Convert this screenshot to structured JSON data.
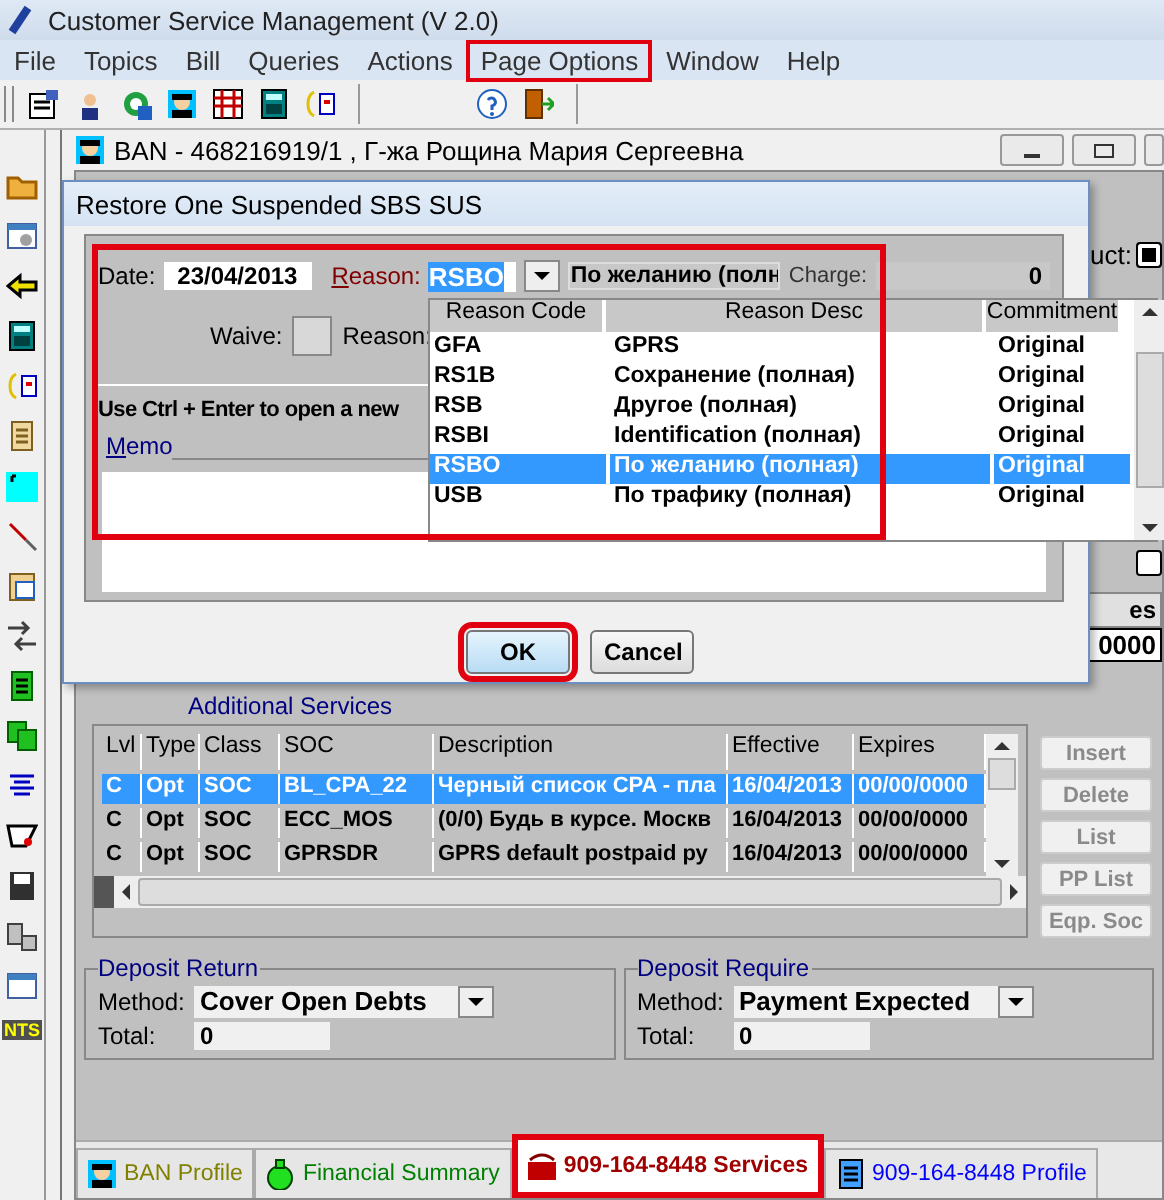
{
  "window": {
    "title": "Customer Service Management  (V 2.0)"
  },
  "menu": [
    {
      "label": "File",
      "highlighted": false
    },
    {
      "label": "Topics",
      "highlighted": false
    },
    {
      "label": "Bill",
      "highlighted": false
    },
    {
      "label": "Queries",
      "highlighted": false
    },
    {
      "label": "Actions",
      "highlighted": false
    },
    {
      "label": "Page Options",
      "highlighted": true
    },
    {
      "label": "Window",
      "highlighted": false
    },
    {
      "label": "Help",
      "highlighted": false
    }
  ],
  "left_toolbar": {
    "badge": "NTS"
  },
  "account_window": {
    "title": "BAN - 468216919/1 , Г-жа Рощина Мария Сергеевна"
  },
  "background_fields": {
    "label": "uct:",
    "checkboxes": [
      {
        "checked": true
      },
      {
        "checked": false
      }
    ],
    "button": "es",
    "value": "0000"
  },
  "dialog": {
    "title": "Restore One Suspended SBS SUS",
    "highlighted": true,
    "date_label": "Date:",
    "date": "23/04/2013",
    "reason_label": "Reason:",
    "reason_code": "RSBO",
    "reason_desc": "По желанию (полн",
    "charge_label": "Charge:",
    "charge": "0",
    "waive_label": "Waive:",
    "waive_checked": false,
    "waive_reason_label": "Reason:",
    "hint": "Use Ctrl + Enter to open a new",
    "memo_label": "Memo",
    "buttons": [
      {
        "label": "OK",
        "highlighted": true
      },
      {
        "label": "Cancel",
        "highlighted": false
      }
    ]
  },
  "reason_dropdown": {
    "columns": [
      "Reason Code",
      "Reason Desc",
      "Commitment"
    ],
    "rows": [
      {
        "code": "GFA",
        "desc": "GPRS",
        "commitment": "Original",
        "selected": false
      },
      {
        "code": "RS1B",
        "desc": "Сохранение (полная)",
        "commitment": "Original",
        "selected": false
      },
      {
        "code": "RSB",
        "desc": "Другое (полная)",
        "commitment": "Original",
        "selected": false
      },
      {
        "code": "RSBI",
        "desc": "Identification (полная)",
        "commitment": "Original",
        "selected": false
      },
      {
        "code": "RSBO",
        "desc": "По желанию (полная)",
        "commitment": "Original",
        "selected": true
      },
      {
        "code": "USB",
        "desc": "По трафику (полная)",
        "commitment": "Original",
        "selected": false
      }
    ]
  },
  "services": {
    "title": "Additional Services",
    "columns": [
      "Lvl",
      "Type",
      "Class",
      "SOC",
      "Description",
      "Effective",
      "Expires"
    ],
    "rows": [
      {
        "cells": [
          "C",
          "Opt",
          "SOC",
          "BL_CPA_22",
          "Черный список CPA - пла",
          "16/04/2013",
          "00/00/0000"
        ],
        "selected": true
      },
      {
        "cells": [
          "C",
          "Opt",
          "SOC",
          "ECC_MOS",
          "(0/0) Будь в курсе. Москв",
          "16/04/2013",
          "00/00/0000"
        ],
        "selected": false
      },
      {
        "cells": [
          "C",
          "Opt",
          "SOC",
          "GPRSDR",
          "GPRS default postpaid ру",
          "16/04/2013",
          "00/00/0000"
        ],
        "selected": false
      }
    ]
  },
  "side_buttons": [
    {
      "label": "Insert",
      "disabled": true
    },
    {
      "label": "Delete",
      "disabled": true
    },
    {
      "label": "List",
      "disabled": true
    },
    {
      "label": "PP List",
      "disabled": true
    },
    {
      "label": "Eqp. Soc",
      "disabled": true
    }
  ],
  "deposit_return": {
    "title": "Deposit Return",
    "method_label": "Method:",
    "method": "Cover Open Debts",
    "total_label": "Total:",
    "total": "0"
  },
  "deposit_require": {
    "title": "Deposit Require",
    "method_label": "Method:",
    "method": "Payment Expected",
    "total_label": "Total:",
    "total": "0"
  },
  "tabs": [
    {
      "label": "BAN Profile",
      "color": "#808000",
      "selected": false,
      "highlighted": false
    },
    {
      "label": "Financial Summary",
      "color": "#008000",
      "selected": false,
      "highlighted": false
    },
    {
      "label": "909-164-8448 Services",
      "color": "#a00000",
      "selected": true,
      "highlighted": true
    },
    {
      "label": "909-164-8448 Profile",
      "color": "#0000ff",
      "selected": false,
      "highlighted": false
    }
  ]
}
